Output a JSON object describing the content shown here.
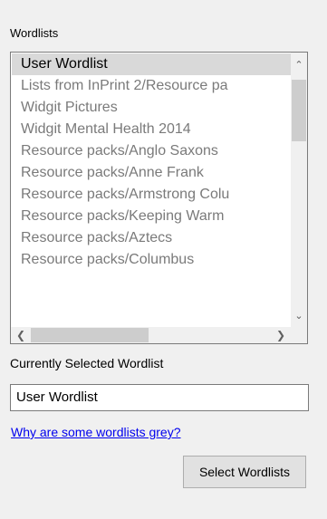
{
  "wordlists": {
    "label": "Wordlists",
    "items": [
      {
        "label": "User Wordlist",
        "state": "selected"
      },
      {
        "label": "Lists from InPrint 2/Resource pa",
        "state": "grey"
      },
      {
        "label": "Widgit Pictures",
        "state": "grey"
      },
      {
        "label": "Widgit Mental Health 2014",
        "state": "grey"
      },
      {
        "label": "Resource packs/Anglo Saxons",
        "state": "grey"
      },
      {
        "label": "Resource packs/Anne Frank",
        "state": "grey"
      },
      {
        "label": "Resource packs/Armstrong Colu",
        "state": "grey"
      },
      {
        "label": "Resource packs/Keeping Warm",
        "state": "grey"
      },
      {
        "label": "Resource packs/Aztecs",
        "state": "grey"
      },
      {
        "label": "Resource packs/Columbus",
        "state": "grey"
      }
    ]
  },
  "selected": {
    "label": "Currently Selected Wordlist",
    "value": "User Wordlist"
  },
  "help_link": "Why are some wordlists grey?",
  "select_button": "Select Wordlists"
}
